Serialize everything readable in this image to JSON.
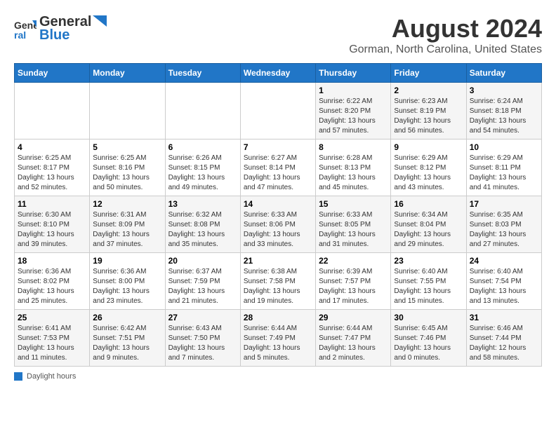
{
  "header": {
    "logo_line1": "General",
    "logo_line2": "Blue",
    "month_year": "August 2024",
    "location": "Gorman, North Carolina, United States"
  },
  "days_of_week": [
    "Sunday",
    "Monday",
    "Tuesday",
    "Wednesday",
    "Thursday",
    "Friday",
    "Saturday"
  ],
  "weeks": [
    [
      {
        "day": "",
        "info": ""
      },
      {
        "day": "",
        "info": ""
      },
      {
        "day": "",
        "info": ""
      },
      {
        "day": "",
        "info": ""
      },
      {
        "day": "1",
        "info": "Sunrise: 6:22 AM\nSunset: 8:20 PM\nDaylight: 13 hours\nand 57 minutes."
      },
      {
        "day": "2",
        "info": "Sunrise: 6:23 AM\nSunset: 8:19 PM\nDaylight: 13 hours\nand 56 minutes."
      },
      {
        "day": "3",
        "info": "Sunrise: 6:24 AM\nSunset: 8:18 PM\nDaylight: 13 hours\nand 54 minutes."
      }
    ],
    [
      {
        "day": "4",
        "info": "Sunrise: 6:25 AM\nSunset: 8:17 PM\nDaylight: 13 hours\nand 52 minutes."
      },
      {
        "day": "5",
        "info": "Sunrise: 6:25 AM\nSunset: 8:16 PM\nDaylight: 13 hours\nand 50 minutes."
      },
      {
        "day": "6",
        "info": "Sunrise: 6:26 AM\nSunset: 8:15 PM\nDaylight: 13 hours\nand 49 minutes."
      },
      {
        "day": "7",
        "info": "Sunrise: 6:27 AM\nSunset: 8:14 PM\nDaylight: 13 hours\nand 47 minutes."
      },
      {
        "day": "8",
        "info": "Sunrise: 6:28 AM\nSunset: 8:13 PM\nDaylight: 13 hours\nand 45 minutes."
      },
      {
        "day": "9",
        "info": "Sunrise: 6:29 AM\nSunset: 8:12 PM\nDaylight: 13 hours\nand 43 minutes."
      },
      {
        "day": "10",
        "info": "Sunrise: 6:29 AM\nSunset: 8:11 PM\nDaylight: 13 hours\nand 41 minutes."
      }
    ],
    [
      {
        "day": "11",
        "info": "Sunrise: 6:30 AM\nSunset: 8:10 PM\nDaylight: 13 hours\nand 39 minutes."
      },
      {
        "day": "12",
        "info": "Sunrise: 6:31 AM\nSunset: 8:09 PM\nDaylight: 13 hours\nand 37 minutes."
      },
      {
        "day": "13",
        "info": "Sunrise: 6:32 AM\nSunset: 8:08 PM\nDaylight: 13 hours\nand 35 minutes."
      },
      {
        "day": "14",
        "info": "Sunrise: 6:33 AM\nSunset: 8:06 PM\nDaylight: 13 hours\nand 33 minutes."
      },
      {
        "day": "15",
        "info": "Sunrise: 6:33 AM\nSunset: 8:05 PM\nDaylight: 13 hours\nand 31 minutes."
      },
      {
        "day": "16",
        "info": "Sunrise: 6:34 AM\nSunset: 8:04 PM\nDaylight: 13 hours\nand 29 minutes."
      },
      {
        "day": "17",
        "info": "Sunrise: 6:35 AM\nSunset: 8:03 PM\nDaylight: 13 hours\nand 27 minutes."
      }
    ],
    [
      {
        "day": "18",
        "info": "Sunrise: 6:36 AM\nSunset: 8:02 PM\nDaylight: 13 hours\nand 25 minutes."
      },
      {
        "day": "19",
        "info": "Sunrise: 6:36 AM\nSunset: 8:00 PM\nDaylight: 13 hours\nand 23 minutes."
      },
      {
        "day": "20",
        "info": "Sunrise: 6:37 AM\nSunset: 7:59 PM\nDaylight: 13 hours\nand 21 minutes."
      },
      {
        "day": "21",
        "info": "Sunrise: 6:38 AM\nSunset: 7:58 PM\nDaylight: 13 hours\nand 19 minutes."
      },
      {
        "day": "22",
        "info": "Sunrise: 6:39 AM\nSunset: 7:57 PM\nDaylight: 13 hours\nand 17 minutes."
      },
      {
        "day": "23",
        "info": "Sunrise: 6:40 AM\nSunset: 7:55 PM\nDaylight: 13 hours\nand 15 minutes."
      },
      {
        "day": "24",
        "info": "Sunrise: 6:40 AM\nSunset: 7:54 PM\nDaylight: 13 hours\nand 13 minutes."
      }
    ],
    [
      {
        "day": "25",
        "info": "Sunrise: 6:41 AM\nSunset: 7:53 PM\nDaylight: 13 hours\nand 11 minutes."
      },
      {
        "day": "26",
        "info": "Sunrise: 6:42 AM\nSunset: 7:51 PM\nDaylight: 13 hours\nand 9 minutes."
      },
      {
        "day": "27",
        "info": "Sunrise: 6:43 AM\nSunset: 7:50 PM\nDaylight: 13 hours\nand 7 minutes."
      },
      {
        "day": "28",
        "info": "Sunrise: 6:44 AM\nSunset: 7:49 PM\nDaylight: 13 hours\nand 5 minutes."
      },
      {
        "day": "29",
        "info": "Sunrise: 6:44 AM\nSunset: 7:47 PM\nDaylight: 13 hours\nand 2 minutes."
      },
      {
        "day": "30",
        "info": "Sunrise: 6:45 AM\nSunset: 7:46 PM\nDaylight: 13 hours\nand 0 minutes."
      },
      {
        "day": "31",
        "info": "Sunrise: 6:46 AM\nSunset: 7:44 PM\nDaylight: 12 hours\nand 58 minutes."
      }
    ]
  ],
  "footer": {
    "label": "Daylight hours"
  }
}
